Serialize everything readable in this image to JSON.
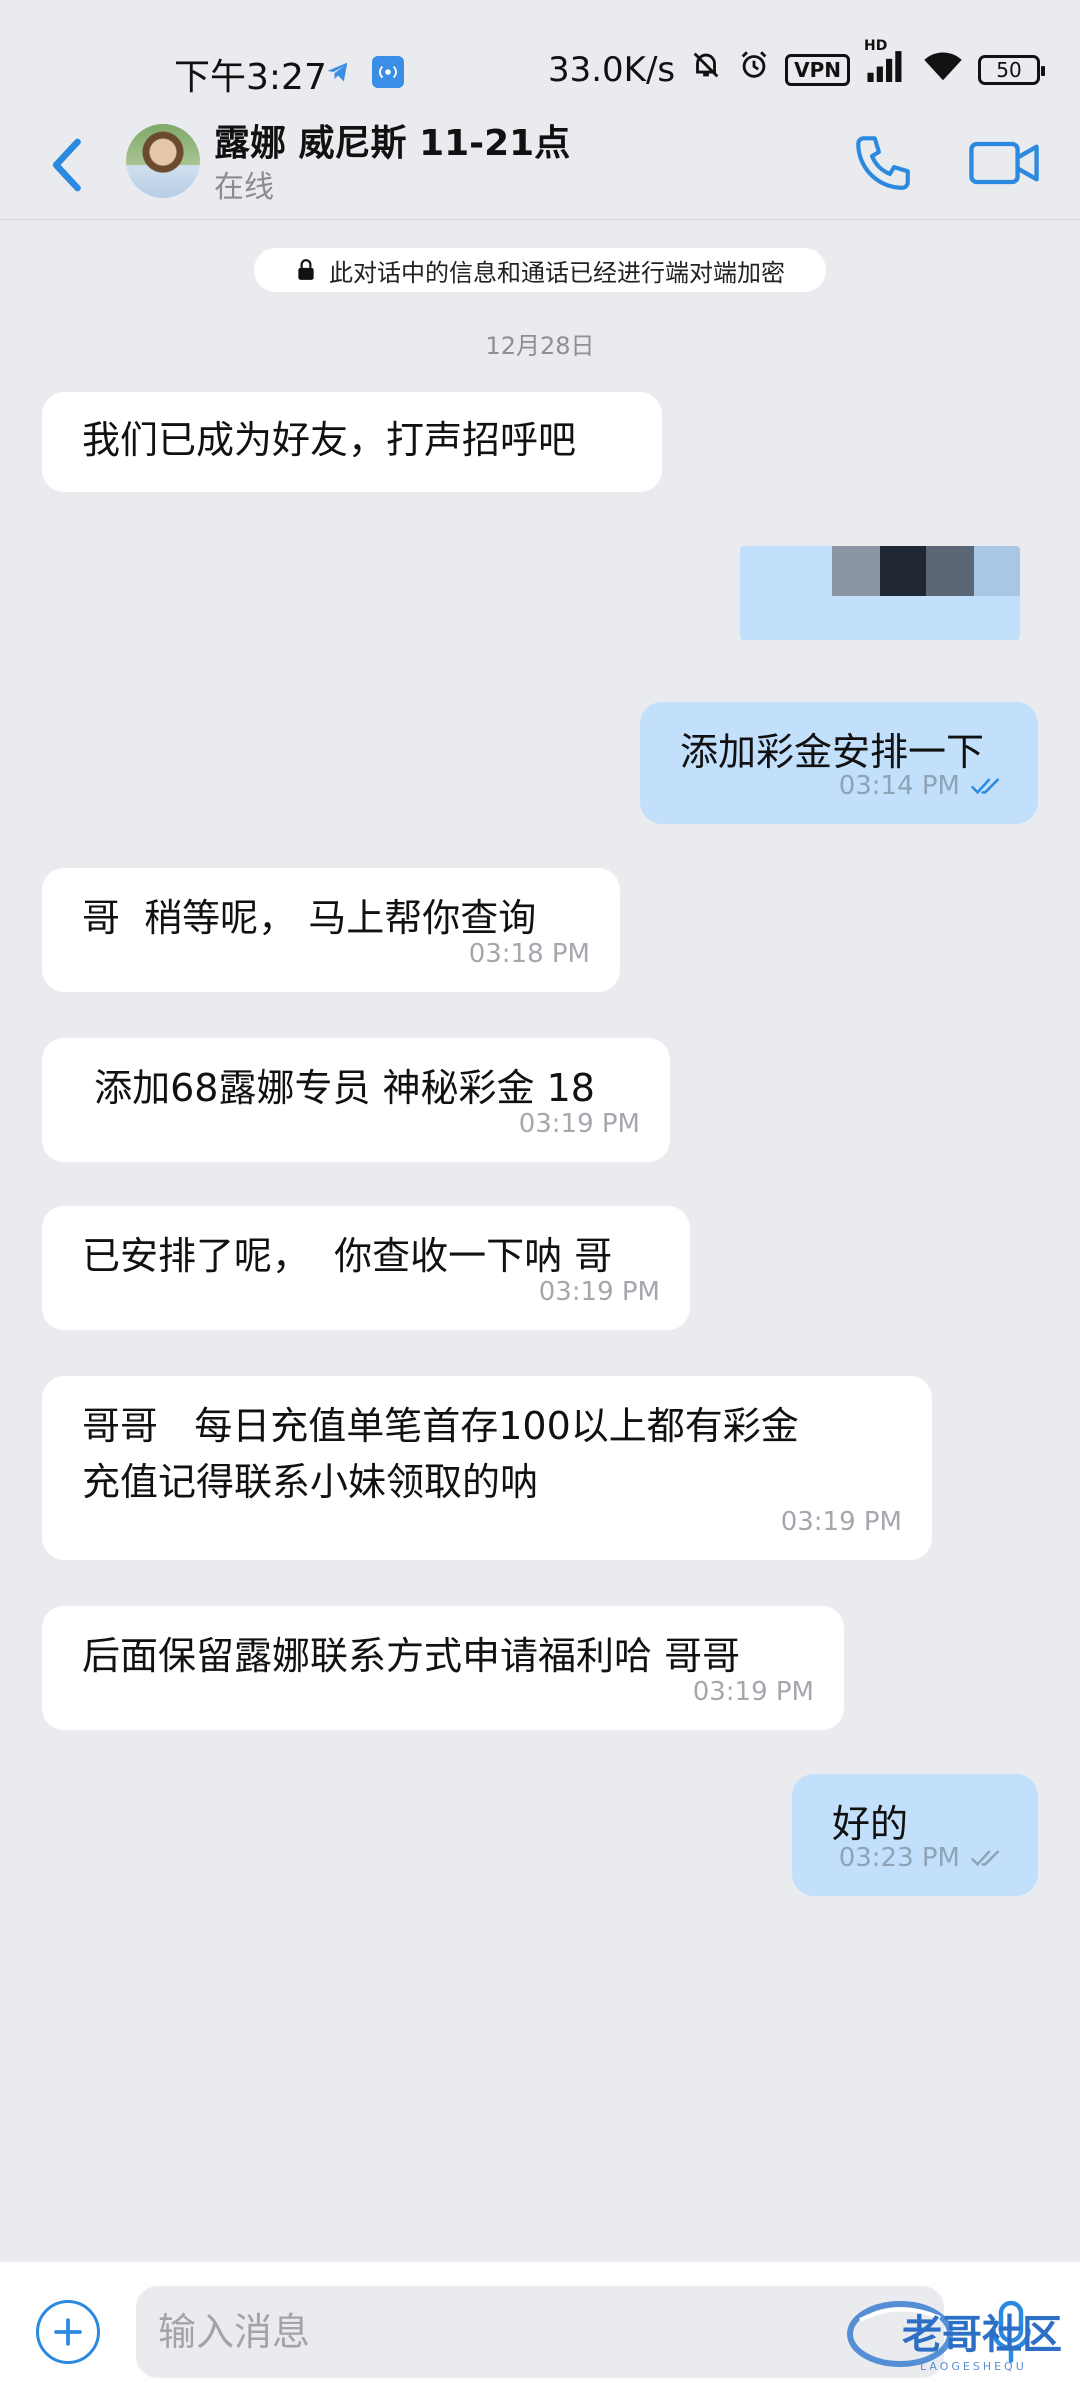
{
  "status_bar": {
    "time": "下午3:27",
    "net_speed": "33.0K/s",
    "vpn_label": "VPN",
    "hd_label": "HD",
    "battery": "50"
  },
  "header": {
    "contact_name": "露娜 威尼斯 11-21点",
    "contact_status": "在线"
  },
  "chat": {
    "encryption_notice": "此对话中的信息和通话已经进行端对端加密",
    "date_separator": "12月28日",
    "messages": [
      {
        "direction": "in",
        "text": "我们已成为好友，打声招呼吧",
        "time": ""
      },
      {
        "direction": "out",
        "text": "添加彩金安排一下",
        "time": "03:14 PM",
        "read": true
      },
      {
        "direction": "in",
        "text": "哥  稍等呢， 马上帮你查询",
        "time": "03:18 PM"
      },
      {
        "direction": "in",
        "text": " 添加68露娜专员 神秘彩金 18",
        "time": "03:19 PM"
      },
      {
        "direction": "in",
        "text": "已安排了呢，  你查收一下呐 哥",
        "time": "03:19 PM"
      },
      {
        "direction": "in",
        "text": "哥哥   每日充值单笔首存100以上都有彩金\n充值记得联系小妹领取的呐",
        "time": "03:19 PM"
      },
      {
        "direction": "in",
        "text": "后面保留露娜联系方式申请福利哈 哥哥",
        "time": "03:19 PM"
      },
      {
        "direction": "out",
        "text": "好的",
        "time": "03:23 PM",
        "read": false
      }
    ]
  },
  "input": {
    "placeholder": "输入消息"
  },
  "watermark": {
    "title": "老哥社区",
    "subtitle": "LAOGESHEQU"
  },
  "colors": {
    "accent": "#2b89e0",
    "outgoing_bubble": "#c2e0fb",
    "incoming_bubble": "#ffffff",
    "background": "#eaebef"
  }
}
